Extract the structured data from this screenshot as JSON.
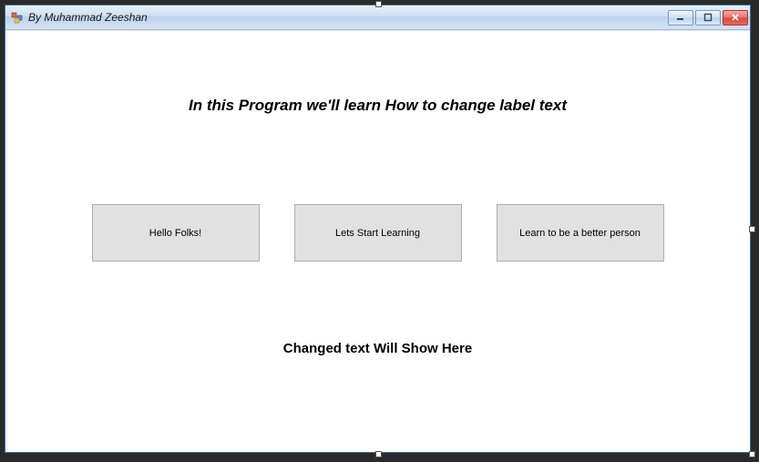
{
  "window": {
    "title": "By Muhammad Zeeshan"
  },
  "heading": "In this Program we'll learn How to change label text",
  "buttons": [
    {
      "label": "Hello Folks!"
    },
    {
      "label": "Lets Start Learning"
    },
    {
      "label": "Learn to be a better person"
    }
  ],
  "result_label": "Changed text Will Show Here"
}
